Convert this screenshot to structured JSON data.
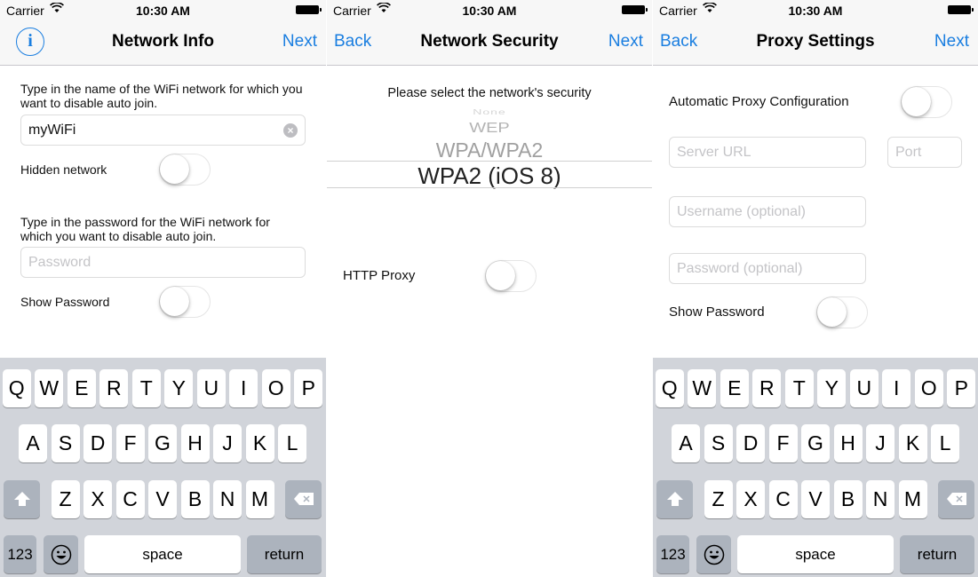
{
  "status_bar": {
    "carrier": "Carrier",
    "time": "10:30 AM"
  },
  "accent_color": "#1a7ee0",
  "screens": {
    "network_info": {
      "nav": {
        "title": "Network Info",
        "left_icon": "info-icon",
        "right": "Next"
      },
      "name_prompt": "Type in the name of the WiFi network for which you want to disable auto join.",
      "name_field": {
        "value": "myWiFi",
        "clear_icon": "×"
      },
      "hidden_network": {
        "label": "Hidden network",
        "on": false
      },
      "password_prompt": "Type in the password for the WiFi network for which you want to disable auto join.",
      "password_field": {
        "placeholder": "Password",
        "value": ""
      },
      "show_password": {
        "label": "Show Password",
        "on": false
      }
    },
    "network_security": {
      "nav": {
        "left": "Back",
        "title": "Network Security",
        "right": "Next"
      },
      "prompt": "Please select the network's security",
      "picker_options": [
        "None",
        "WEP",
        "WPA/WPA2",
        "WPA2 (iOS 8)"
      ],
      "picker_selected": "WPA2 (iOS 8)",
      "http_proxy": {
        "label": "HTTP Proxy",
        "on": false
      }
    },
    "proxy_settings": {
      "nav": {
        "left": "Back",
        "title": "Proxy Settings",
        "right": "Next"
      },
      "auto_proxy": {
        "label": "Automatic Proxy Configuration",
        "on": false
      },
      "server_url": {
        "placeholder": "Server URL",
        "value": ""
      },
      "port": {
        "placeholder": "Port",
        "value": ""
      },
      "username": {
        "placeholder": "Username (optional)",
        "value": ""
      },
      "password": {
        "placeholder": "Password (optional)",
        "value": ""
      },
      "show_password": {
        "label": "Show Password",
        "on": false
      }
    }
  },
  "keyboard": {
    "row1": [
      "Q",
      "W",
      "E",
      "R",
      "T",
      "Y",
      "U",
      "I",
      "O",
      "P"
    ],
    "row2": [
      "A",
      "S",
      "D",
      "F",
      "G",
      "H",
      "J",
      "K",
      "L"
    ],
    "row3": [
      "Z",
      "X",
      "C",
      "V",
      "B",
      "N",
      "M"
    ],
    "shift_icon": "shift-icon",
    "delete_icon": "delete-icon",
    "numbers": "123",
    "emoji_icon": "emoji-icon",
    "space": "space",
    "return": "return"
  }
}
